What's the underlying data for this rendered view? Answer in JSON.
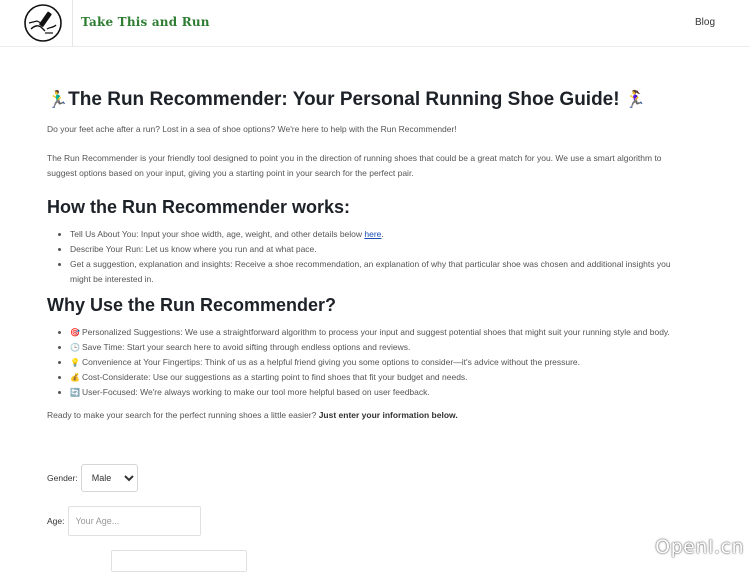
{
  "header": {
    "brand": "Take This and Run",
    "nav_blog": "Blog"
  },
  "hero": {
    "emoji_left": "🏃‍♂️",
    "title": "The Run Recommender: Your Personal Running Shoe Guide!",
    "emoji_right": "🏃‍♀️"
  },
  "intro": {
    "p1": "Do your feet ache after a run? Lost in a sea of shoe options? We're here to help with the Run Recommender!",
    "p2": "The Run Recommender is your friendly tool designed to point you in the direction of running shoes that could be a great match for you. We use a smart algorithm to suggest options based on your input, giving you a starting point in your search for the perfect pair."
  },
  "how": {
    "heading": "How the Run Recommender works:",
    "item1_text": "Tell Us About You: Input your shoe width, age, weight, and other details below ",
    "item1_link": "here",
    "item1_end": ".",
    "item2": "Describe Your Run: Let us know where you run and at what pace.",
    "item3": "Get a suggestion, explanation and insights: Receive a shoe recommendation, an explanation of why that particular shoe was chosen and additional insights you might be interested in."
  },
  "why": {
    "heading": "Why Use the Run Recommender?",
    "items": [
      {
        "emoji": "🎯",
        "text": "Personalized Suggestions: We use a straightforward algorithm to process your input and suggest potential shoes that might suit your running style and body."
      },
      {
        "emoji": "🕒",
        "text": "Save Time: Start your search here to avoid sifting through endless options and reviews."
      },
      {
        "emoji": "💡",
        "text": "Convenience at Your Fingertips: Think of us as a helpful friend giving you some options to consider—it's advice without the pressure."
      },
      {
        "emoji": "💰",
        "text": "Cost-Considerate: Use our suggestions as a starting point to find shoes that fit your budget and needs."
      },
      {
        "emoji": "🔄",
        "text": "User-Focused: We're always working to make our tool more helpful based on user feedback."
      }
    ]
  },
  "cta": {
    "text": "Ready to make your search for the perfect running shoes a little easier? ",
    "bold": "Just enter your information below."
  },
  "form": {
    "gender_label": "Gender:",
    "gender_value": "Male",
    "age_label": "Age:",
    "age_placeholder": "Your Age..."
  },
  "watermark": "OpenI.cn"
}
